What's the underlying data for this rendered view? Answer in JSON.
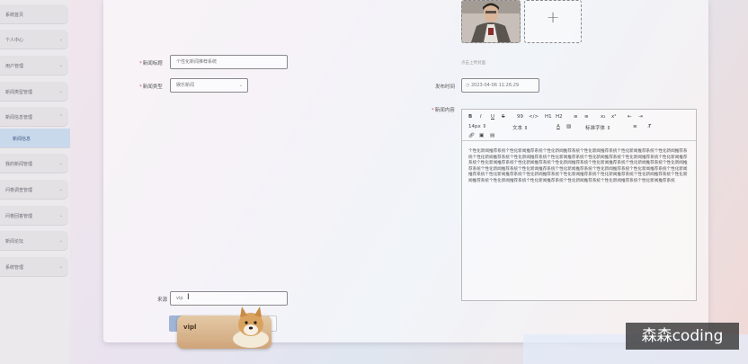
{
  "sidebar": {
    "items": [
      {
        "label": "系统首页"
      },
      {
        "label": "个人中心"
      },
      {
        "label": "用户管理"
      },
      {
        "label": "新闻类型管理"
      },
      {
        "label": "新闻信息管理"
      },
      {
        "label": "新闻信息"
      },
      {
        "label": "我的新闻管理"
      },
      {
        "label": "问卷调查管理"
      },
      {
        "label": "问卷回答管理"
      },
      {
        "label": "新闻论坛"
      },
      {
        "label": "系统管理"
      }
    ]
  },
  "form": {
    "title_label": "新闻标题",
    "title_value": "个性化新闻推荐系统",
    "type_label": "新闻类型",
    "type_value": "娱乐新闻",
    "cover_hint": "点击上传封面",
    "publish_label": "发布时间",
    "publish_value": "2023-04-06 11:26:29",
    "content_label": "新闻内容",
    "source_label": "来源",
    "source_value": "vip",
    "required_mark": "*"
  },
  "editor": {
    "toolbar_row1": [
      "B",
      "I",
      "U",
      "S",
      "99",
      "</>",
      "H1",
      "H2",
      "≡",
      "≡",
      "x₂",
      "x²",
      "⇤",
      "⇥"
    ],
    "toolbar_row2": {
      "size": "14px",
      "text": "文本",
      "font": "标准字体"
    },
    "content": "个性化新闻推荐系统个性化新闻推荐系统个性化新闻推荐系统个性化新闻推荐系统个性化新闻推荐系统个性化新闻推荐系统个性化新闻推荐系统个性化新闻推荐系统个性化新闻推荐系统个性化新闻推荐系统个性化新闻推荐系统个性化新闻推荐系统个性化新闻推荐系统个性化新闻推荐系统个性化新闻推荐系统个性化新闻推荐系统个性化新闻推荐系统个性化新闻推荐系统个性化新闻推荐系统个性化新闻推荐系统个性化新闻推荐系统个性化新闻推荐系统个性化新闻推荐系统个性化新闻推荐系统个性化新闻推荐系统个性化新闻推荐系统个性化新闻推荐系统个性化新闻推荐系统个性化新闻推荐系统个性化新闻推荐系统个性化新闻推荐系统个性化新闻推荐系统个性化新闻推荐系统个性化新闻推荐系统个性化新闻推荐系统"
  },
  "overlay": {
    "sticker_text": "vipl",
    "watermark": "森森coding"
  }
}
